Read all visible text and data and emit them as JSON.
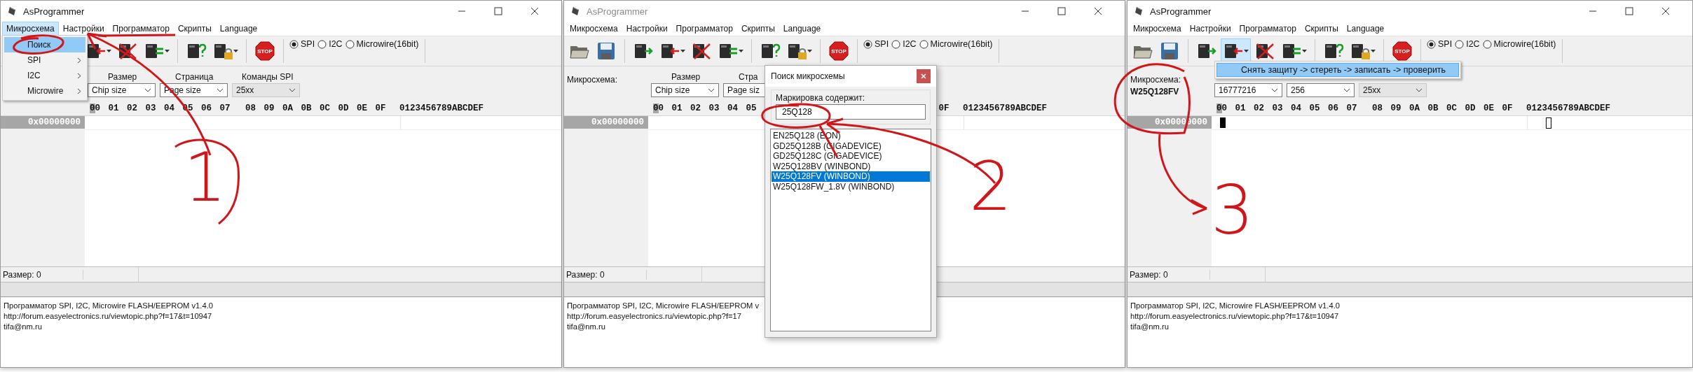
{
  "windows": [
    {
      "title": "AsProgrammer",
      "active": true,
      "menu": [
        {
          "label": "Микросхема",
          "selected": true
        },
        {
          "label": "Настройки",
          "selected": false
        },
        {
          "label": "Программатор",
          "selected": false
        },
        {
          "label": "Скрипты",
          "selected": false
        },
        {
          "label": "Language",
          "selected": false
        }
      ],
      "open_menu": [
        {
          "label": "Поиск",
          "selected": true,
          "submenu": false
        },
        {
          "label": "SPI",
          "selected": false,
          "submenu": true
        },
        {
          "label": "I2C",
          "selected": false,
          "submenu": true
        },
        {
          "label": "Microwire",
          "selected": false,
          "submenu": true
        }
      ],
      "toolbar": [
        {
          "kind": "write",
          "dropdown": true,
          "pressed": false
        },
        {
          "kind": "erase",
          "dropdown": false,
          "pressed": false
        },
        {
          "kind": "verify",
          "dropdown": true,
          "pressed": false
        },
        {
          "kind": "id",
          "dropdown": false,
          "pressed": false
        },
        {
          "kind": "protect",
          "dropdown": true,
          "pressed": false
        },
        {
          "kind": "stop",
          "label": "STOP",
          "dropdown": false,
          "pressed": false
        }
      ],
      "protocols": [
        {
          "label": "SPI",
          "selected": true
        },
        {
          "label": "I2C",
          "selected": false
        },
        {
          "label": "Microwire(16bit)",
          "selected": false
        }
      ],
      "combo_labels": [
        "Размер",
        "Страница",
        "Команды SPI"
      ],
      "combos": [
        {
          "value": "Chip size",
          "disabled": false
        },
        {
          "value": "Page size",
          "disabled": false
        },
        {
          "value": "25xx",
          "disabled": true
        }
      ],
      "hex_columns": [
        "00",
        "01",
        "02",
        "03",
        "04",
        "05",
        "06",
        "07",
        "08",
        "09",
        "0A",
        "0B",
        "0C",
        "0D",
        "0E",
        "0F"
      ],
      "ascii_header": "0123456789ABCDEF",
      "row_address": "0x00000000",
      "cursor": false,
      "status": "Размер: 0",
      "log": [
        "Программатор SPI, I2C, Microwire FLASH/EEPROM v1.4.0",
        "http://forum.easyelectronics.ru/viewtopic.php?f=17&t=10947",
        "tifa@nm.ru"
      ]
    },
    {
      "title": "AsProgrammer",
      "active": false,
      "menu": [
        {
          "label": "Микросхема",
          "selected": false
        },
        {
          "label": "Настройки",
          "selected": false
        },
        {
          "label": "Программатор",
          "selected": false
        },
        {
          "label": "Скрипты",
          "selected": false
        },
        {
          "label": "Language",
          "selected": false
        }
      ],
      "toolbar": [
        {
          "kind": "open",
          "dropdown": false,
          "pressed": false
        },
        {
          "kind": "save",
          "dropdown": false,
          "pressed": false
        },
        {
          "kind": "read",
          "dropdown": false,
          "pressed": false
        },
        {
          "kind": "write",
          "dropdown": true,
          "pressed": false
        },
        {
          "kind": "erase",
          "dropdown": false,
          "pressed": false
        },
        {
          "kind": "verify",
          "dropdown": true,
          "pressed": false
        },
        {
          "kind": "id",
          "dropdown": false,
          "pressed": false
        },
        {
          "kind": "protect",
          "dropdown": true,
          "pressed": false
        },
        {
          "kind": "stop",
          "label": "STOP",
          "dropdown": false,
          "pressed": false
        }
      ],
      "protocols": [
        {
          "label": "SPI",
          "selected": true
        },
        {
          "label": "I2C",
          "selected": false
        },
        {
          "label": "Microwire(16bit)",
          "selected": false
        }
      ],
      "chip_label": "Микросхема:",
      "combo_labels": [
        "Размер",
        "Стра"
      ],
      "combos": [
        {
          "value": "Chip size",
          "disabled": false
        },
        {
          "value": "Page siz",
          "disabled": false
        }
      ],
      "hex_columns": [
        "00",
        "01",
        "02",
        "03",
        "04",
        "05",
        null,
        null,
        null,
        null,
        null,
        null,
        null,
        null,
        null,
        "0F"
      ],
      "ascii_header": "0123456789ABCDEF",
      "row_address": "0x00000000",
      "cursor": false,
      "status": "Размер: 0",
      "log": [
        "Программатор SPI, I2C, Microwire FLASH/EEPROM v",
        "http://forum.easyelectronics.ru/viewtopic.php?f=17",
        "tifa@nm.ru"
      ],
      "dialog": {
        "title": "Поиск микросхемы",
        "field_label": "Маркировка содержит:",
        "field_value": "25Q128",
        "results": [
          {
            "label": "EN25Q128 (EON)",
            "selected": false
          },
          {
            "label": "GD25Q128B (GIGADEVICE)",
            "selected": false
          },
          {
            "label": "GD25Q128C (GIGADEVICE)",
            "selected": false
          },
          {
            "label": "W25Q128BV (WINBOND)",
            "selected": false
          },
          {
            "label": "W25Q128FV (WINBOND)",
            "selected": true
          },
          {
            "label": "W25Q128FW_1.8V (WINBOND)",
            "selected": false
          }
        ]
      }
    },
    {
      "title": "AsProgrammer",
      "active": true,
      "menu": [
        {
          "label": "Микросхема",
          "selected": false
        },
        {
          "label": "Настройки",
          "selected": false
        },
        {
          "label": "Программатор",
          "selected": false
        },
        {
          "label": "Скрипты",
          "selected": false
        },
        {
          "label": "Language",
          "selected": false
        }
      ],
      "toolbar": [
        {
          "kind": "open",
          "dropdown": false,
          "pressed": false
        },
        {
          "kind": "save",
          "dropdown": false,
          "pressed": false
        },
        {
          "kind": "read",
          "dropdown": false,
          "pressed": false
        },
        {
          "kind": "write",
          "dropdown": true,
          "pressed": true
        },
        {
          "kind": "erase",
          "dropdown": false,
          "pressed": false
        },
        {
          "kind": "verify",
          "dropdown": true,
          "pressed": false
        },
        {
          "kind": "id",
          "dropdown": false,
          "pressed": false
        },
        {
          "kind": "protect",
          "dropdown": true,
          "pressed": false
        },
        {
          "kind": "stop",
          "label": "STOP",
          "dropdown": false,
          "pressed": false
        }
      ],
      "protocols": [
        {
          "label": "SPI",
          "selected": true
        },
        {
          "label": "I2C",
          "selected": false
        },
        {
          "label": "Microwire(16bit)",
          "selected": false
        }
      ],
      "chip_label": "Микросхема:",
      "chip_value": "W25Q128FV",
      "combos": [
        {
          "value": "16777216",
          "disabled": false
        },
        {
          "value": "256",
          "disabled": false
        },
        {
          "value": "25xx",
          "disabled": true
        }
      ],
      "hex_columns": [
        "00",
        "01",
        "02",
        "03",
        "04",
        "05",
        "06",
        "07",
        "08",
        "09",
        "0A",
        "0B",
        "0C",
        "0D",
        "0E",
        "0F"
      ],
      "ascii_header": "0123456789ABCDEF",
      "row_address": "0x00000000",
      "cursor": true,
      "status": "Размер: 0",
      "log": [
        "Программатор SPI, I2C, Microwire FLASH/EEPROM v1.4.0",
        "http://forum.easyelectronics.ru/viewtopic.php?f=17&t=10947",
        "tifa@nm.ru"
      ],
      "dropdown_menu": [
        {
          "label": "Снять защиту -> стереть -> записать -> проверить",
          "selected": true
        }
      ]
    }
  ],
  "annotations": [
    {
      "number": "1"
    },
    {
      "number": "2"
    },
    {
      "number": "3"
    }
  ]
}
